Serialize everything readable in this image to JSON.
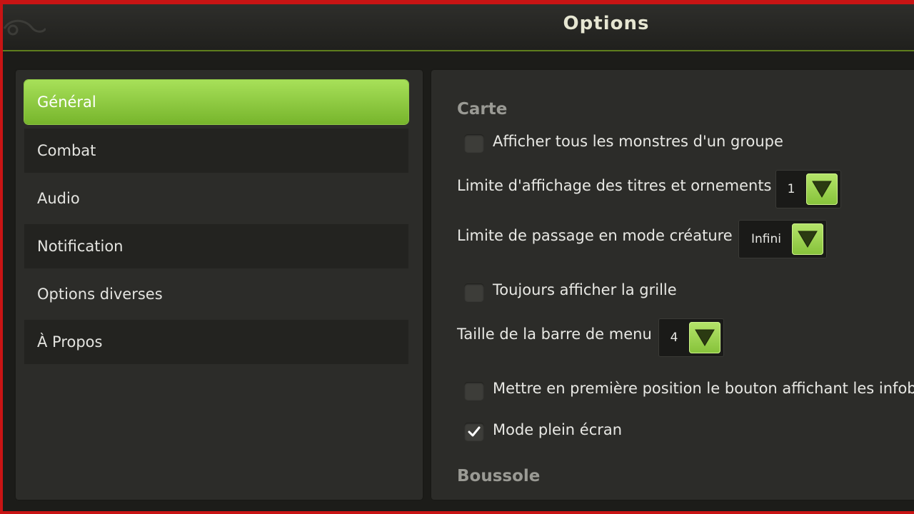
{
  "window": {
    "title": "Options"
  },
  "sidebar": {
    "items": [
      {
        "label": "Général",
        "active": true
      },
      {
        "label": "Combat"
      },
      {
        "label": "Audio"
      },
      {
        "label": "Notification"
      },
      {
        "label": "Options diverses"
      },
      {
        "label": "À Propos"
      }
    ]
  },
  "content": {
    "section_carte": "Carte",
    "show_all_monsters": {
      "label": "Afficher tous les monstres d'un groupe",
      "checked": false
    },
    "titles_limit": {
      "label": "Limite d'affichage des titres et ornements",
      "value": "1"
    },
    "creature_mode_limit": {
      "label": "Limite de passage en mode créature",
      "value": "Infini"
    },
    "always_grid": {
      "label": "Toujours afficher la grille",
      "checked": false
    },
    "menu_bar_size": {
      "label": "Taille de la barre de menu",
      "value": "4"
    },
    "infobubble_first": {
      "label": "Mettre en première position le bouton affichant les infobu",
      "checked": false
    },
    "fullscreen": {
      "label": "Mode plein écran",
      "checked": true
    },
    "section_boussole": "Boussole"
  },
  "colors": {
    "accent": "#8fcb45",
    "background": "#2c2c29",
    "frame": "#c81414"
  }
}
